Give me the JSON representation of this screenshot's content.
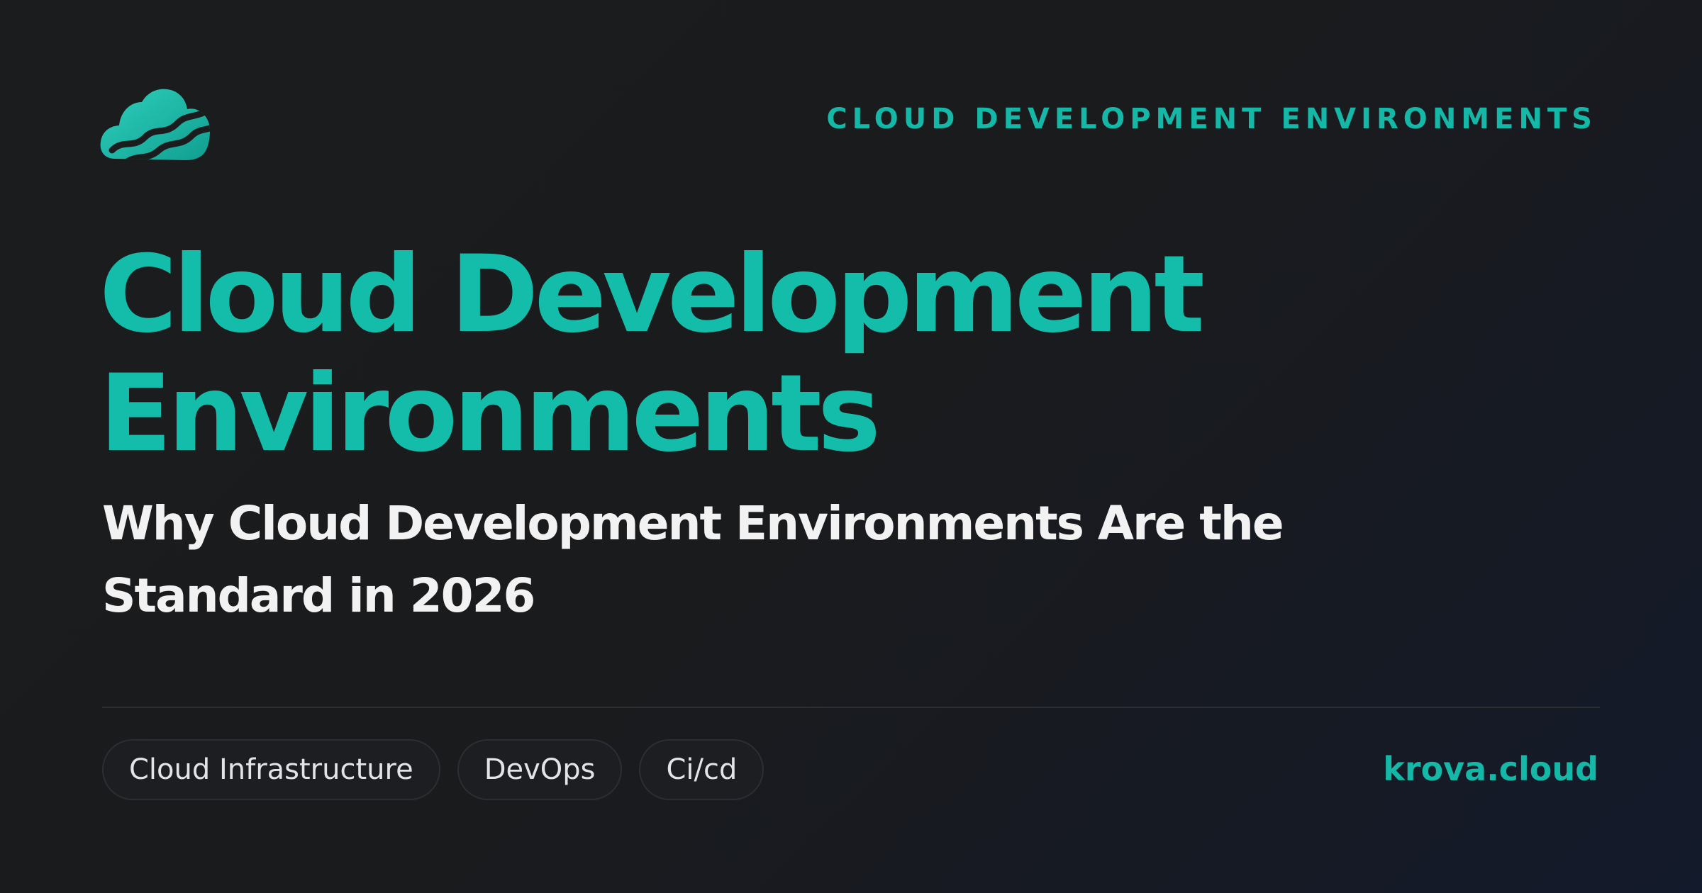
{
  "brand": {
    "logo_icon": "cloud-logo-icon",
    "accent_color": "#14bdaa"
  },
  "header": {
    "category": "CLOUD DEVELOPMENT ENVIRONMENTS"
  },
  "main": {
    "title_lines": [
      "Cloud Development",
      "Environments"
    ],
    "subtitle": "Why Cloud Development Environments Are the Standard in 2026"
  },
  "footer": {
    "tags": [
      "Cloud Infrastructure",
      "DevOps",
      "Ci/cd"
    ],
    "site": "krova.cloud"
  }
}
